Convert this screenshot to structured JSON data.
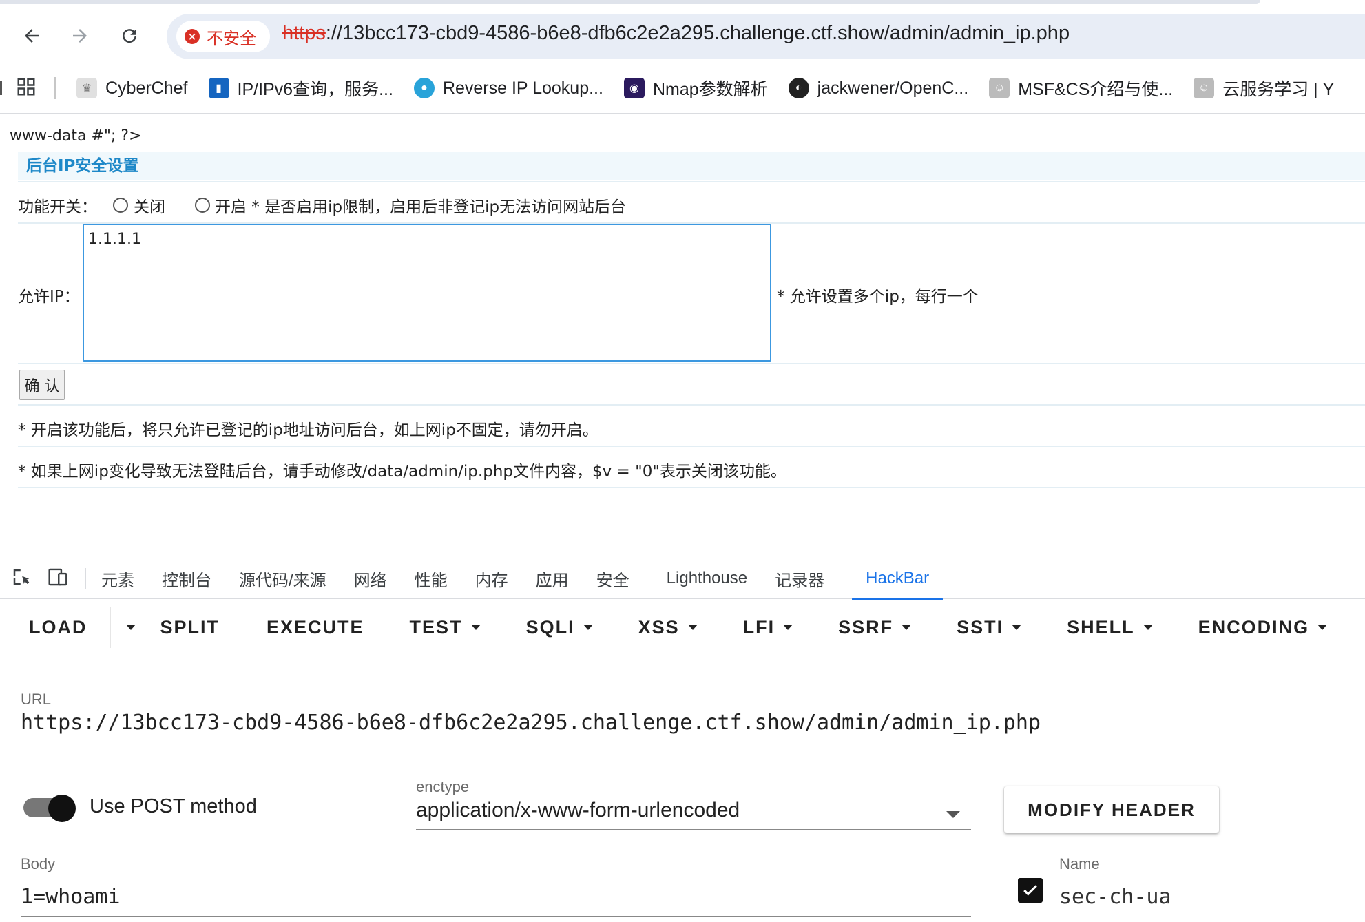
{
  "browser": {
    "security_label": "不安全",
    "url_scheme": "https",
    "url_rest": "://13bcc173-cbd9-4586-b6e8-dfb6c2e2a295.challenge.ctf.show/admin/admin_ip.php",
    "bookmarks": [
      {
        "label": "CyberChef",
        "icon": "chef-hat-icon"
      },
      {
        "label": "IP/IPv6查询，服务...",
        "icon": "ip-lookup-icon"
      },
      {
        "label": "Reverse IP Lookup...",
        "icon": "location-pin-icon"
      },
      {
        "label": "Nmap参数解析",
        "icon": "eye-icon"
      },
      {
        "label": "jackwener/OpenC...",
        "icon": "github-icon"
      },
      {
        "label": "MSF&CS介绍与使...",
        "icon": "avatar-icon"
      },
      {
        "label": "云服务学习 | Y",
        "icon": "avatar-icon"
      }
    ]
  },
  "page": {
    "leak_text": "www-data #\"; ?>",
    "section_title": "后台IP安全设置",
    "switch_label": "功能开关：",
    "radio_off_label": "关闭",
    "radio_on_label": "开启 * 是否启用ip限制，启用后非登记ip无法访问网站后台",
    "allow_ip_label": "允许IP：",
    "allow_ip_value": "1.1.1.1",
    "allow_ip_hint": "* 允许设置多个ip，每行一个",
    "confirm_label": "确 认",
    "note1": "* 开启该功能后，将只允许已登记的ip地址访问后台，如上网ip不固定，请勿开启。",
    "note2": "* 如果上网ip变化导致无法登陆后台，请手动修改/data/admin/ip.php文件内容，$v = \"0\"表示关闭该功能。"
  },
  "devtools": {
    "tabs": [
      "元素",
      "控制台",
      "源代码/来源",
      "网络",
      "性能",
      "内存",
      "应用",
      "安全",
      "Lighthouse",
      "记录器",
      "HackBar"
    ],
    "active_tab": "HackBar"
  },
  "hackbar": {
    "toolbar": [
      "LOAD",
      "SPLIT",
      "EXECUTE",
      "TEST",
      "SQLI",
      "XSS",
      "LFI",
      "SSRF",
      "SSTI",
      "SHELL",
      "ENCODING"
    ],
    "url_label": "URL",
    "url_value": "https://13bcc173-cbd9-4586-b6e8-dfb6c2e2a295.challenge.ctf.show/admin/admin_ip.php",
    "post_label": "Use POST method",
    "post_enabled": true,
    "enctype_label": "enctype",
    "enctype_value": "application/x-www-form-urlencoded",
    "modify_header_label": "MODIFY HEADER",
    "body_label": "Body",
    "body_value": "1=whoami",
    "header_name_label": "Name",
    "header_name_value": "sec-ch-ua",
    "header_enabled": true
  },
  "colors": {
    "accent": "#1a73e8",
    "danger": "#d93025",
    "section_title": "#1e88c8"
  }
}
